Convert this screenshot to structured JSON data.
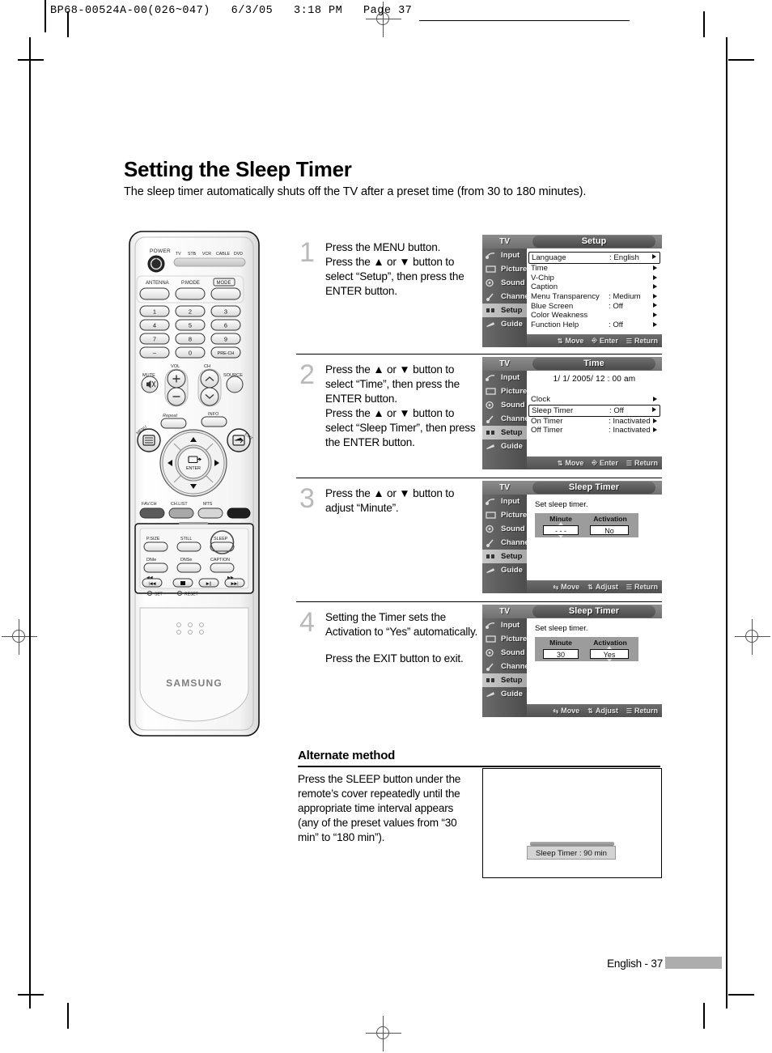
{
  "print_header": "BP68-00524A-00(026~047)   6/3/05   3:18 PM   Page 37",
  "page": {
    "title": "Setting the Sleep Timer",
    "subtitle": "The sleep timer automatically shuts off the TV after a preset time (from 30 to 180 minutes).",
    "footer_label": "English - 37"
  },
  "steps": [
    {
      "number": "1",
      "lines": [
        "Press the MENU button.",
        "Press the ▲ or ▼ button to select “Setup”, then press the ENTER button."
      ]
    },
    {
      "number": "2",
      "lines": [
        "Press the ▲ or ▼ button to select “Time”, then press the ENTER button.",
        "Press the ▲ or ▼ button to select “Sleep Timer”, then press the ENTER button."
      ]
    },
    {
      "number": "3",
      "lines": [
        "Press the ▲ or ▼ button to adjust “Minute”."
      ]
    },
    {
      "number": "4",
      "lines": [
        "Setting the Timer sets the Activation to “Yes” automatically.",
        "Press the EXIT button to exit."
      ]
    }
  ],
  "osd_common": {
    "tv_label": "TV",
    "sidebar": [
      "Input",
      "Picture",
      "Sound",
      "Channel",
      "Setup",
      "Guide"
    ],
    "sidebar_active": "Setup",
    "hint_move": "Move",
    "hint_enter": "Enter",
    "hint_adjust": "Adjust",
    "hint_return": "Return"
  },
  "osd_screens": [
    {
      "title": "Setup",
      "rows": [
        {
          "key": "Language",
          "value": ": English",
          "selected": true,
          "arrow": true
        },
        {
          "key": "Time",
          "value": "",
          "selected": false,
          "arrow": true
        },
        {
          "key": "V-Chip",
          "value": "",
          "selected": false,
          "arrow": true
        },
        {
          "key": "Caption",
          "value": "",
          "selected": false,
          "arrow": true
        },
        {
          "key": "Menu Transparency",
          "value": ": Medium",
          "selected": false,
          "arrow": true
        },
        {
          "key": "Blue Screen",
          "value": ": Off",
          "selected": false,
          "arrow": true
        },
        {
          "key": "Color Weakness",
          "value": "",
          "selected": false,
          "arrow": true
        },
        {
          "key": "Function Help",
          "value": ": Off",
          "selected": false,
          "arrow": true
        }
      ],
      "footer": [
        "Move",
        "Enter",
        "Return"
      ]
    },
    {
      "title": "Time",
      "clock": "1/  1/ 2005/ 12 : 00 am",
      "rows": [
        {
          "key": "Clock",
          "value": "",
          "selected": false,
          "arrow": true
        },
        {
          "key": "Sleep Timer",
          "value": ": Off",
          "selected": true,
          "arrow": true
        },
        {
          "key": "On Timer",
          "value": ": Inactivated",
          "selected": false,
          "arrow": true
        },
        {
          "key": "Off Timer",
          "value": ": Inactivated",
          "selected": false,
          "arrow": true
        }
      ],
      "footer": [
        "Move",
        "Enter",
        "Return"
      ]
    },
    {
      "title": "Sleep Timer",
      "caption": "Set sleep timer.",
      "table": {
        "headers": [
          "Minute",
          "Activation"
        ],
        "minute": "- - -",
        "activation": "No",
        "spinner_on": "minute"
      },
      "footer": [
        "Move",
        "Adjust",
        "Return"
      ]
    },
    {
      "title": "Sleep Timer",
      "caption": "Set sleep timer.",
      "table": {
        "headers": [
          "Minute",
          "Activation"
        ],
        "minute": "30",
        "activation": "Yes",
        "spinner_on": "activation"
      },
      "footer": [
        "Move",
        "Adjust",
        "Return"
      ]
    }
  ],
  "alternate": {
    "heading": "Alternate method",
    "text": "Press the SLEEP button under the remote’s cover repeatedly until the appropriate time interval appears (any of the preset values from “30 min” to “180 min”).",
    "osd_chip": "Sleep Timer : 90 min"
  },
  "remote": {
    "brand": "SAMSUNG",
    "power_label": "POWER",
    "mode_strip": [
      "TV",
      "STB",
      "VCR",
      "CABLE",
      "DVD"
    ],
    "row_top": [
      "ANTENNA",
      "P.MODE",
      "MODE"
    ],
    "keypad": [
      "1",
      "2",
      "3",
      "4",
      "5",
      "6",
      "7",
      "8",
      "9",
      "–",
      "0",
      "PRE-CH"
    ],
    "vol_label": "VOL",
    "ch_label": "CH",
    "mute_label": "MUTE",
    "source_label": "SOURCE",
    "menu_label": "MENU",
    "info_label": "INFO",
    "exit_label": "EXIT",
    "enter_label": "ENTER",
    "reset_row": [
      "FAV.CH",
      "CH.LIST",
      "MTS"
    ],
    "cover_row1": [
      "P.SIZE",
      "STILL",
      "SLEEP"
    ],
    "cover_row2": [
      "DNIe",
      "DNSe",
      "CAPTION"
    ],
    "set_label": "SET",
    "reset_label": "RESET",
    "highlight": "SLEEP"
  }
}
